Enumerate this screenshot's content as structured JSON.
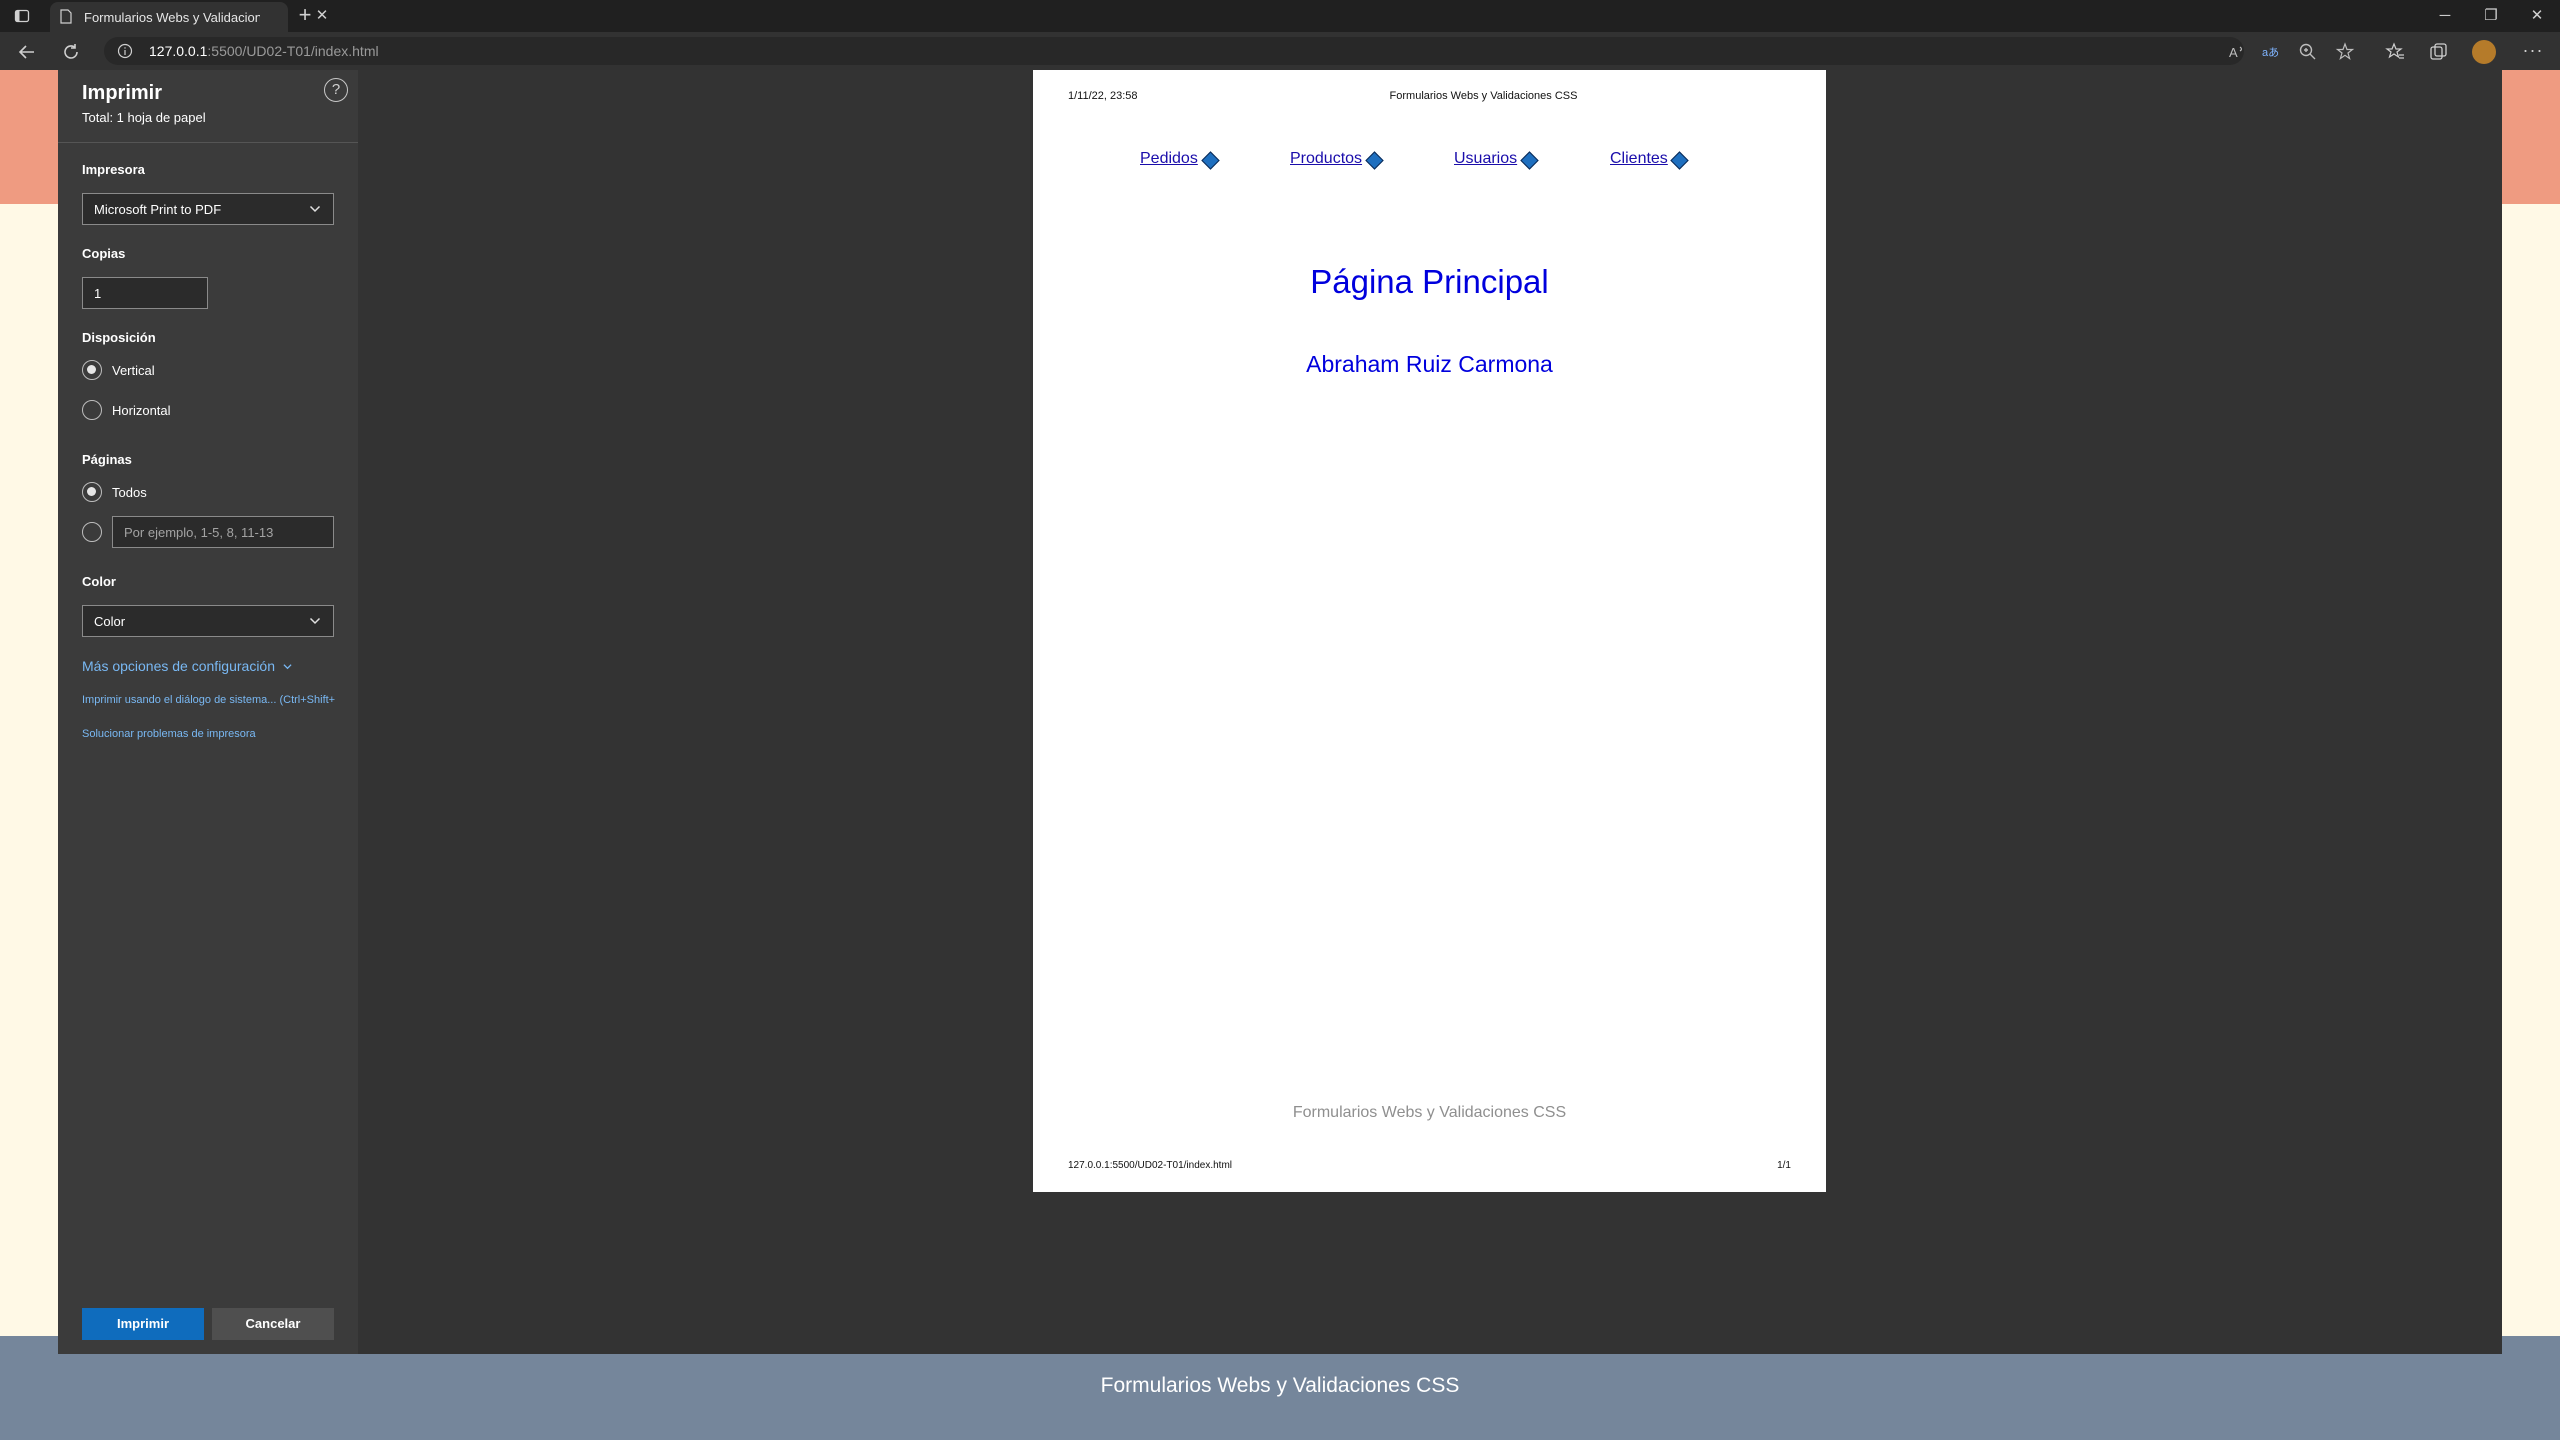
{
  "browser": {
    "tab_title": "Formularios Webs y Validaciones CSS",
    "close_tab": "✕",
    "new_tab": "+",
    "window_minimize": "─",
    "window_restore": "❐",
    "window_close": "✕",
    "url_host": "127.0.0.1",
    "url_rest": ":5500/UD02-T01/index.html",
    "more_menu": "···"
  },
  "page_behind": {
    "footer_text": "Formularios Webs y Validaciones CSS"
  },
  "print_dialog": {
    "title": "Imprimir",
    "subtitle": "Total: 1 hoja de papel",
    "help": "?",
    "printer_label": "Impresora",
    "printer_value": "Microsoft Print to PDF",
    "copies_label": "Copias",
    "copies_value": "1",
    "layout_label": "Disposición",
    "layout_options": [
      "Vertical",
      "Horizontal"
    ],
    "layout_selected": "Vertical",
    "pages_label": "Páginas",
    "pages_all": "Todos",
    "pages_placeholder": "Por ejemplo, 1-5, 8, 11-13",
    "color_label": "Color",
    "color_value": "Color",
    "more_settings": "Más opciones de configuración",
    "system_dialog": "Imprimir usando el diálogo de sistema... (Ctrl+Shift+",
    "troubleshoot": "Solucionar problemas de impresora",
    "print_button": "Imprimir",
    "cancel_button": "Cancelar"
  },
  "preview": {
    "header_date": "1/11/22, 23:58",
    "header_title": "Formularios Webs y Validaciones CSS",
    "nav": [
      "Pedidos",
      "Productos",
      "Usuarios",
      "Clientes"
    ],
    "heading": "Página Principal",
    "author": "Abraham Ruiz Carmona",
    "page_footer": "Formularios Webs y Validaciones CSS",
    "footer_url": "127.0.0.1:5500/UD02-T01/index.html",
    "footer_page": "1/1"
  },
  "colors": {
    "accent": "#0f6cbd",
    "link": "#79b8f3",
    "heading_blue": "#0000dd",
    "page_header": "#ef9b81",
    "page_footer": "#75869b"
  }
}
